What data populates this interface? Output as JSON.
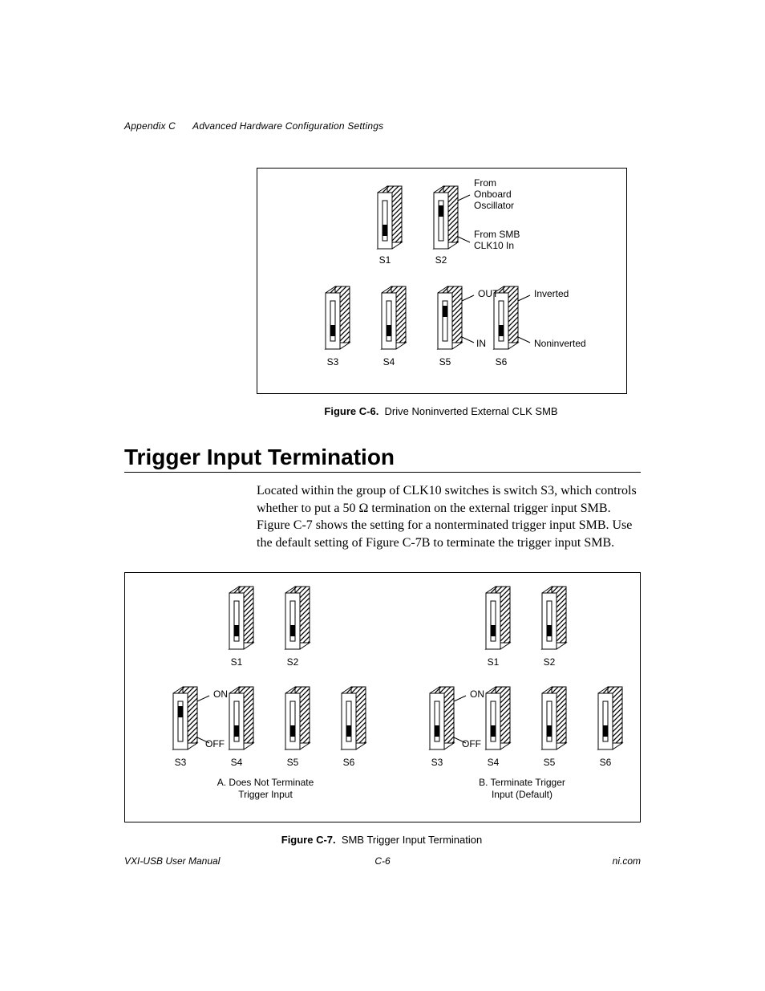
{
  "runhead": {
    "appendix": "Appendix C",
    "title": "Advanced Hardware Configuration Settings"
  },
  "fig6": {
    "cap_num": "Figure C-6.",
    "cap_txt": "Drive Noninverted External CLK SMB",
    "labels": {
      "from_onboard1": "From",
      "from_onboard2": "Onboard",
      "from_onboard3": "Oscillator",
      "from_smb1": "From SMB",
      "from_smb2": "CLK10 In",
      "out": "OUT",
      "in": "IN",
      "inverted": "Inverted",
      "noninverted": "Noninverted",
      "S1": "S1",
      "S2": "S2",
      "S3": "S3",
      "S4": "S4",
      "S5": "S5",
      "S6": "S6"
    }
  },
  "section_title": "Trigger Input Termination",
  "para": "Located within the group of CLK10 switches is switch S3, which controls whether to put a 50 Ω termination on the external trigger input SMB. Figure C-7 shows the setting for a nonterminated trigger input SMB. Use the default setting of Figure C-7B to terminate the trigger input SMB.",
  "fig7": {
    "cap_num": "Figure C-7.",
    "cap_txt": "SMB Trigger Input Termination",
    "labels": {
      "ON": "ON",
      "OFF": "OFF",
      "S1": "S1",
      "S2": "S2",
      "S3": "S3",
      "S4": "S4",
      "S5": "S5",
      "S6": "S6",
      "A1": "A. Does Not Terminate",
      "A2": "Trigger Input",
      "B1": "B. Terminate Trigger",
      "B2": "Input (Default)"
    }
  },
  "footer": {
    "left": "VXI-USB User Manual",
    "center": "C-6",
    "right": "ni.com"
  }
}
